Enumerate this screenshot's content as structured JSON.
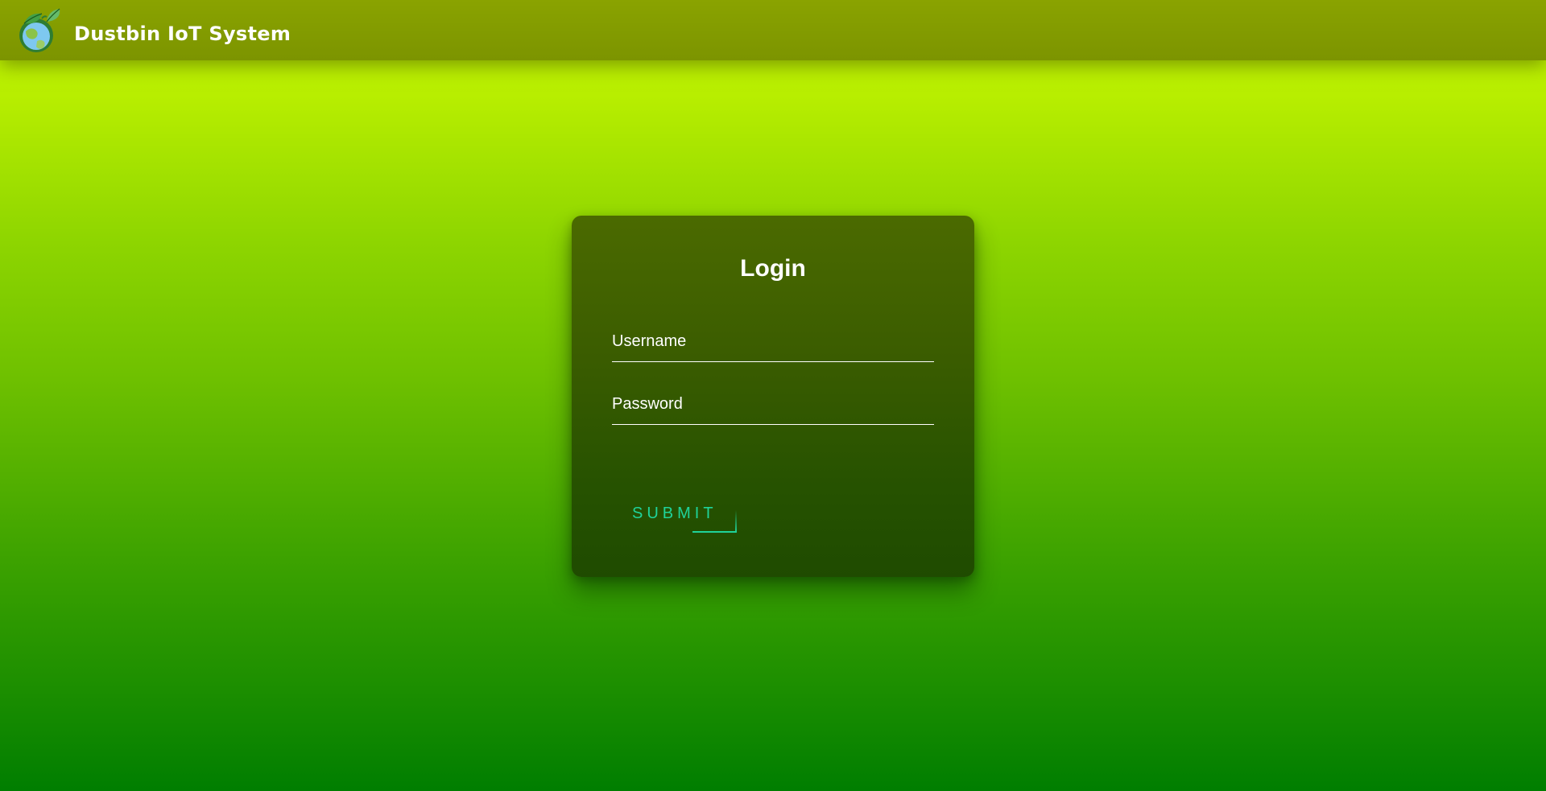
{
  "header": {
    "app_title": "Dustbin IoT System",
    "logo_icon": "globe-with-leaves-icon"
  },
  "login": {
    "title": "Login",
    "username": {
      "value": "",
      "placeholder": "Username"
    },
    "password": {
      "value": "",
      "placeholder": "Password"
    },
    "submit_label": "SUBMIT"
  },
  "colors": {
    "header_bg": "#839c00",
    "page_gradient_top": "#c2f400",
    "page_gradient_bottom": "#007e00",
    "card_bg": "#3a5c00",
    "submit_accent": "#1fd39a",
    "text": "#ffffff"
  }
}
